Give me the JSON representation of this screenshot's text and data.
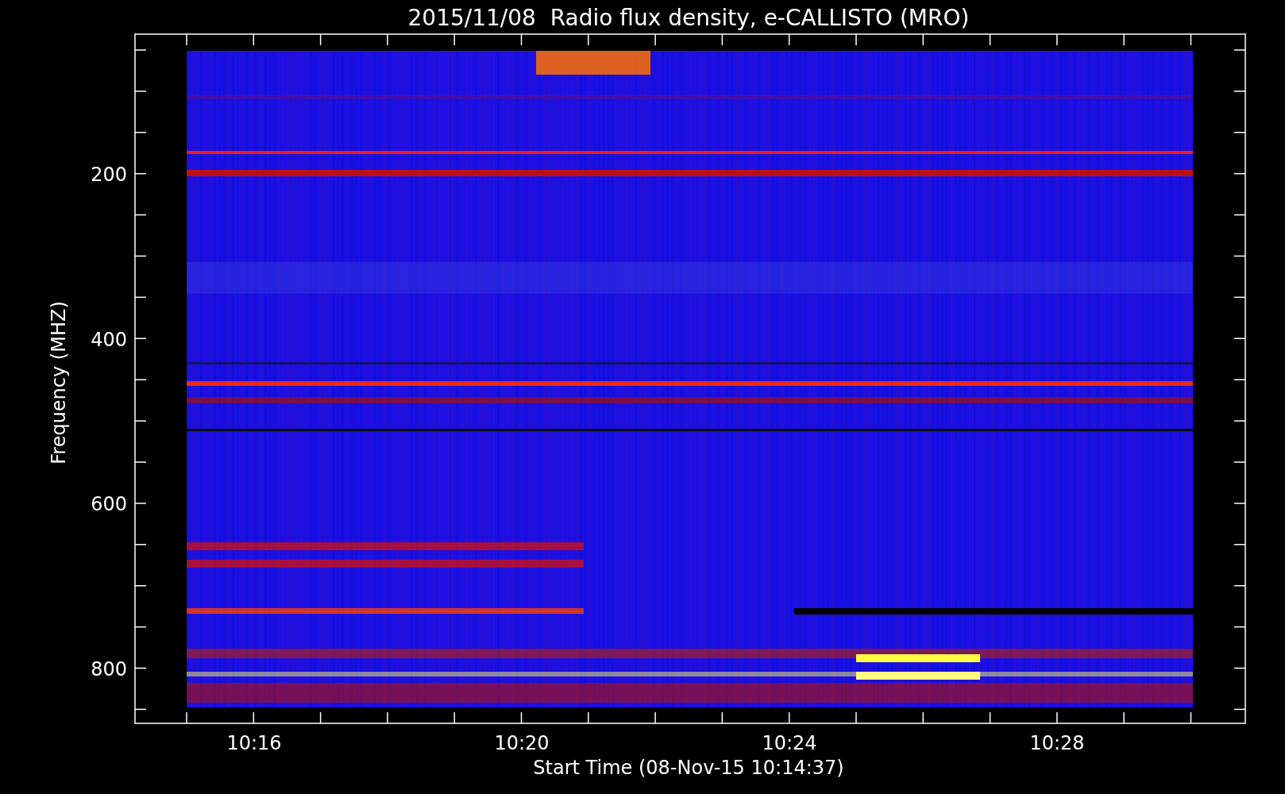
{
  "title": "2015/11/08  Radio flux density, e-CALLISTO (MRO)",
  "y_axis": {
    "label": "Frequency (MHZ)",
    "ticks": [
      "200",
      "400",
      "600",
      "800"
    ]
  },
  "x_axis": {
    "label": "Start Time (08-Nov-15 10:14:37)",
    "ticks": [
      "10:16",
      "10:20",
      "10:24",
      "10:28"
    ]
  }
}
